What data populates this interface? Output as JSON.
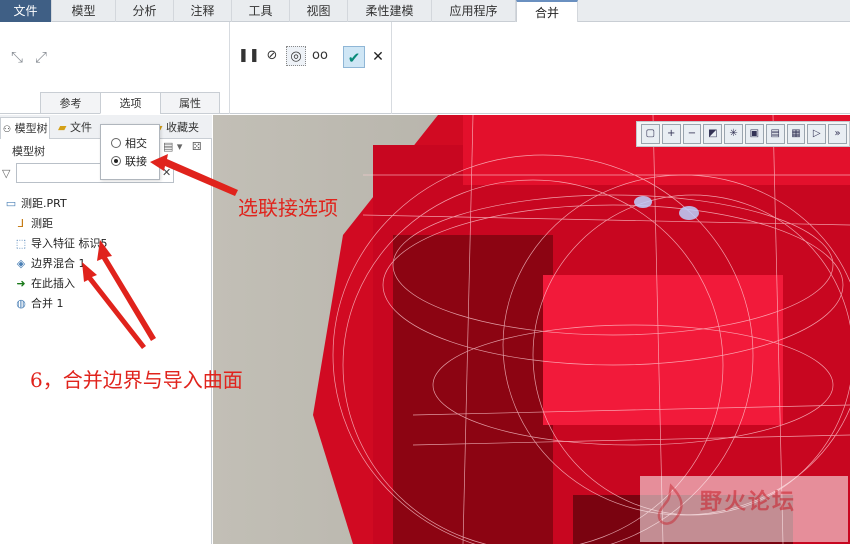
{
  "menu": {
    "file": "文件",
    "tabs": [
      "模型",
      "分析",
      "注释",
      "工具",
      "视图",
      "柔性建模",
      "应用程序"
    ],
    "active_tab": "合并"
  },
  "ribbon": {
    "subtabs": [
      "参考",
      "选项",
      "属性"
    ],
    "active_subtab": "选项",
    "controls": {
      "pause_icon": "pause-icon",
      "stop_icon": "stop-icon",
      "preview_icon": "preview-icon",
      "glasses_icon": "glasses-icon",
      "ok_icon": "check-icon",
      "cancel_icon": "close-icon"
    }
  },
  "options_dropdown": {
    "items": [
      {
        "label": "相交",
        "selected": false
      },
      {
        "label": "联接",
        "selected": true
      }
    ]
  },
  "left_panel": {
    "tabs": [
      "模型树",
      "文件",
      "收藏夹"
    ],
    "title": "模型树",
    "search": {
      "value": "",
      "placeholder": ""
    },
    "tree": [
      {
        "label": "测距.PRT",
        "icon": "part-icon"
      },
      {
        "label": "测距",
        "icon": "coordinate-system-icon"
      },
      {
        "label": "导入特征 标识5",
        "icon": "import-feature-icon"
      },
      {
        "label": "边界混合 1",
        "icon": "boundary-blend-icon"
      },
      {
        "label": "在此插入",
        "icon": "insert-here-arrow-icon"
      },
      {
        "label": "合并 1",
        "icon": "merge-icon"
      }
    ]
  },
  "viewport": {
    "toolbar_icons": [
      "refit-icon",
      "zoom-in-icon",
      "zoom-out-icon",
      "repaint-icon",
      "spin-center-icon",
      "display-style-icon",
      "saved-orientations-icon",
      "view-manager-icon",
      "perspective-icon",
      "more-icon"
    ]
  },
  "annotations": {
    "pick_join": "选联接选项",
    "step6": "6，合并边界与导入曲面"
  },
  "watermark": {
    "text": "野火论坛"
  },
  "colors": {
    "file_tab": "#3f5f85",
    "model_red": "#e0102a",
    "annotation_red": "#e0231c",
    "ok_green": "#0a8a78"
  }
}
